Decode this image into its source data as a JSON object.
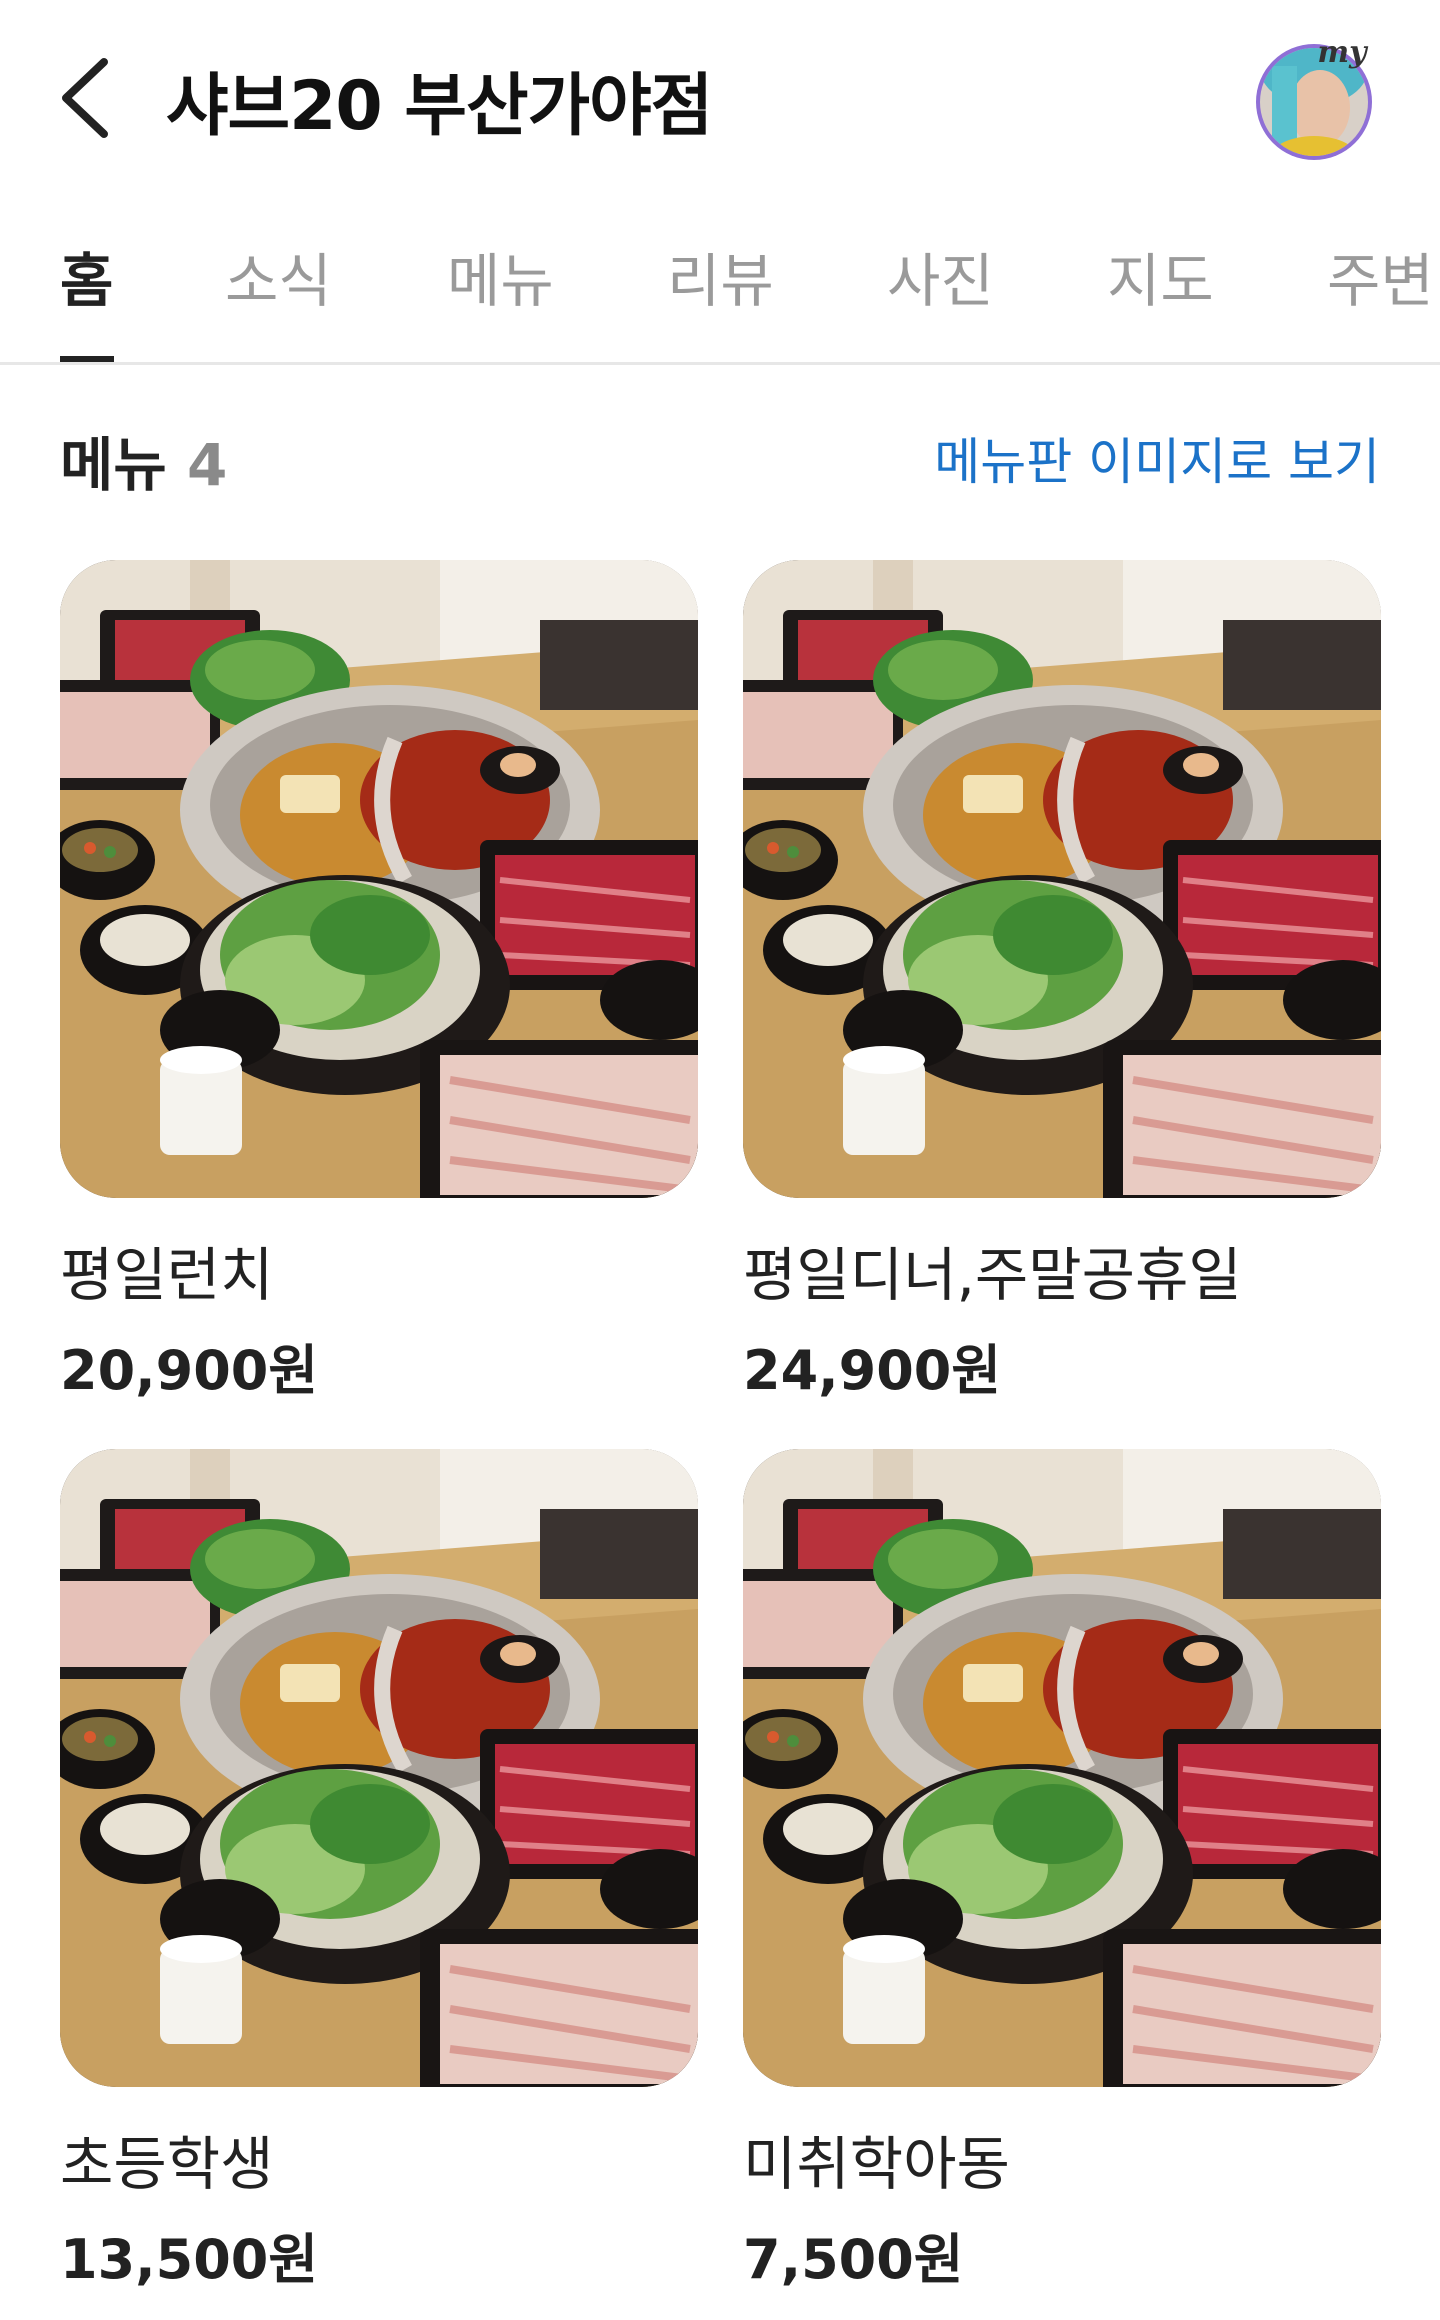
{
  "header": {
    "title": "샤브20 부산가야점",
    "avatar_badge": "my",
    "back_icon": "chevron-left-icon"
  },
  "tabs": [
    "홈",
    "소식",
    "메뉴",
    "리뷰",
    "사진",
    "지도",
    "주변"
  ],
  "active_tab": "홈",
  "menu_section": {
    "title": "메뉴",
    "count": "4",
    "board_link": "메뉴판 이미지로 보기"
  },
  "items": [
    {
      "name": "평일런치",
      "price": "20,900원"
    },
    {
      "name": "평일디너,주말공휴일",
      "price": "24,900원"
    },
    {
      "name": "초등학생",
      "price": "13,500원"
    },
    {
      "name": "미취학아동",
      "price": "7,500원"
    }
  ],
  "colors": {
    "accent_link": "#1b72c8",
    "tab_inactive": "#9a9a9a",
    "text_primary": "#222222"
  }
}
